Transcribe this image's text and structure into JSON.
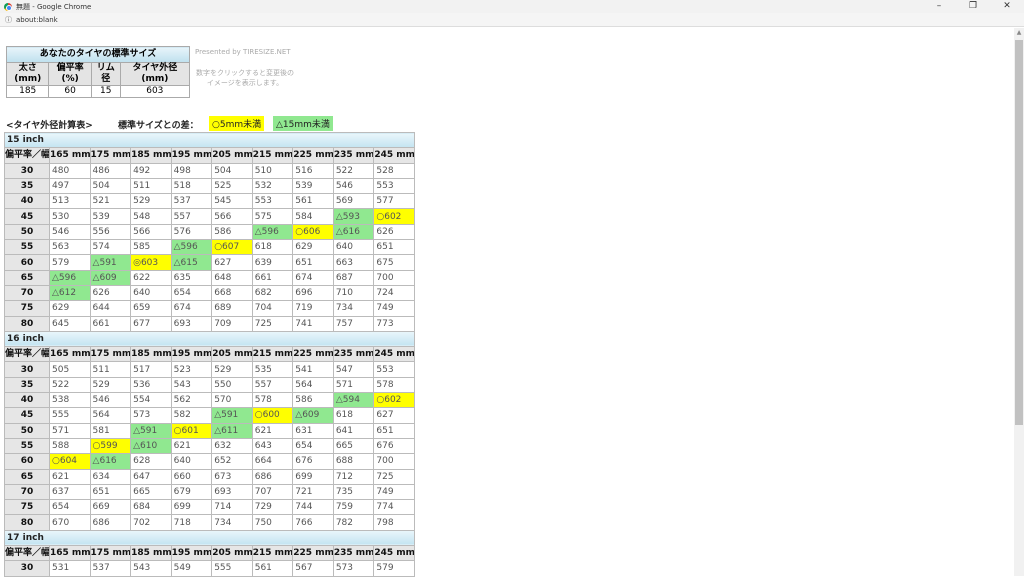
{
  "window": {
    "title": "無題 - Google Chrome",
    "url": "about:blank"
  },
  "standard": {
    "caption": "あなたのタイヤの標準サイズ",
    "headers": [
      "太さ\n(mm)",
      "偏平率\n(%)",
      "リム\n径",
      "タイヤ外径\n(mm)"
    ],
    "values": [
      "185",
      "60",
      "15",
      "603"
    ]
  },
  "presented": "Presented by TIRESIZE.NET",
  "note": "数字をクリックすると変更後のイメージを表示します。",
  "calc_title": "<タイヤ外径計算表>",
  "legend": {
    "label": "標準サイズとの差：",
    "yellow": "○5mm未満",
    "green": "△15mm未満"
  },
  "colors": {
    "yellow": "#ffff00",
    "green": "#90e890",
    "header": "#e6e6e6"
  },
  "table": {
    "corner": "偏平率／幅",
    "widths": [
      "165 mm",
      "175 mm",
      "185 mm",
      "195 mm",
      "205 mm",
      "215 mm",
      "225 mm",
      "235 mm",
      "245 mm"
    ],
    "sections": [
      {
        "title": "15 inch",
        "rows": [
          {
            "ratio": "30",
            "cells": [
              "480",
              "486",
              "492",
              "498",
              "504",
              "510",
              "516",
              "522",
              "528"
            ]
          },
          {
            "ratio": "35",
            "cells": [
              "497",
              "504",
              "511",
              "518",
              "525",
              "532",
              "539",
              "546",
              "553"
            ]
          },
          {
            "ratio": "40",
            "cells": [
              "513",
              "521",
              "529",
              "537",
              "545",
              "553",
              "561",
              "569",
              "577"
            ]
          },
          {
            "ratio": "45",
            "cells": [
              "530",
              "539",
              "548",
              "557",
              "566",
              "575",
              "584",
              "△593",
              "○602"
            ]
          },
          {
            "ratio": "50",
            "cells": [
              "546",
              "556",
              "566",
              "576",
              "586",
              "△596",
              "○606",
              "△616",
              "626"
            ]
          },
          {
            "ratio": "55",
            "cells": [
              "563",
              "574",
              "585",
              "△596",
              "○607",
              "618",
              "629",
              "640",
              "651"
            ]
          },
          {
            "ratio": "60",
            "cells": [
              "579",
              "△591",
              "◎603",
              "△615",
              "627",
              "639",
              "651",
              "663",
              "675"
            ]
          },
          {
            "ratio": "65",
            "cells": [
              "△596",
              "△609",
              "622",
              "635",
              "648",
              "661",
              "674",
              "687",
              "700"
            ]
          },
          {
            "ratio": "70",
            "cells": [
              "△612",
              "626",
              "640",
              "654",
              "668",
              "682",
              "696",
              "710",
              "724"
            ]
          },
          {
            "ratio": "75",
            "cells": [
              "629",
              "644",
              "659",
              "674",
              "689",
              "704",
              "719",
              "734",
              "749"
            ]
          },
          {
            "ratio": "80",
            "cells": [
              "645",
              "661",
              "677",
              "693",
              "709",
              "725",
              "741",
              "757",
              "773"
            ]
          }
        ]
      },
      {
        "title": "16 inch",
        "rows": [
          {
            "ratio": "30",
            "cells": [
              "505",
              "511",
              "517",
              "523",
              "529",
              "535",
              "541",
              "547",
              "553"
            ]
          },
          {
            "ratio": "35",
            "cells": [
              "522",
              "529",
              "536",
              "543",
              "550",
              "557",
              "564",
              "571",
              "578"
            ]
          },
          {
            "ratio": "40",
            "cells": [
              "538",
              "546",
              "554",
              "562",
              "570",
              "578",
              "586",
              "△594",
              "○602"
            ]
          },
          {
            "ratio": "45",
            "cells": [
              "555",
              "564",
              "573",
              "582",
              "△591",
              "○600",
              "△609",
              "618",
              "627"
            ]
          },
          {
            "ratio": "50",
            "cells": [
              "571",
              "581",
              "△591",
              "○601",
              "△611",
              "621",
              "631",
              "641",
              "651"
            ]
          },
          {
            "ratio": "55",
            "cells": [
              "588",
              "○599",
              "△610",
              "621",
              "632",
              "643",
              "654",
              "665",
              "676"
            ]
          },
          {
            "ratio": "60",
            "cells": [
              "○604",
              "△616",
              "628",
              "640",
              "652",
              "664",
              "676",
              "688",
              "700"
            ]
          },
          {
            "ratio": "65",
            "cells": [
              "621",
              "634",
              "647",
              "660",
              "673",
              "686",
              "699",
              "712",
              "725"
            ]
          },
          {
            "ratio": "70",
            "cells": [
              "637",
              "651",
              "665",
              "679",
              "693",
              "707",
              "721",
              "735",
              "749"
            ]
          },
          {
            "ratio": "75",
            "cells": [
              "654",
              "669",
              "684",
              "699",
              "714",
              "729",
              "744",
              "759",
              "774"
            ]
          },
          {
            "ratio": "80",
            "cells": [
              "670",
              "686",
              "702",
              "718",
              "734",
              "750",
              "766",
              "782",
              "798"
            ]
          }
        ]
      },
      {
        "title": "17 inch",
        "rows": [
          {
            "ratio": "30",
            "cells": [
              "531",
              "537",
              "543",
              "549",
              "555",
              "561",
              "567",
              "573",
              "579"
            ]
          }
        ]
      }
    ]
  }
}
